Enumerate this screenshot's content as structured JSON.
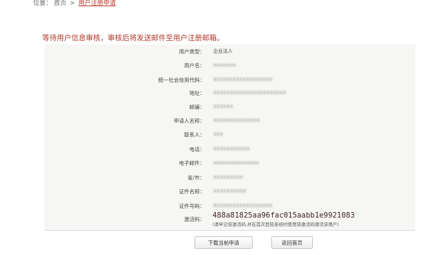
{
  "breadcrumb": {
    "prefix": "位置：",
    "home": "首页",
    "separator": ">",
    "current": "用户注册申请"
  },
  "notice": "等待用户信息审核，审核后将发送邮件至用户注册邮箱。",
  "form": {
    "rows": [
      {
        "label": "用户类型：",
        "value": "企业法人"
      },
      {
        "label": "用户名：",
        "value": "xxxxxxxx"
      },
      {
        "label": "统一社会信用代码：",
        "value": "91XXXXXXXXXXXXXXXX"
      },
      {
        "label": "地址：",
        "value": "XXXXXXXXXXXXXXXXXXXXXX"
      },
      {
        "label": "邮编：",
        "value": "XXXXXX"
      },
      {
        "label": "申请人名称：",
        "value": "XXXXXXXXXXXXXX"
      },
      {
        "label": "联系人：",
        "value": "XXX"
      },
      {
        "label": "电话：",
        "value": "XXXXXXXXXXX"
      },
      {
        "label": "电子邮件：",
        "value": "xxxxxxxxxxxxxxxx"
      },
      {
        "label": "省/市：",
        "value": "XXXXXXXXX"
      },
      {
        "label": "证件名称：",
        "value": "XXXXXXXXXX"
      },
      {
        "label": "证件号码：",
        "value": "91XXXXXXXXXXXXXXXX"
      }
    ],
    "activation": {
      "label": "激活码：",
      "code": "488a81825aa96fac015aabb1e9921083",
      "note": "(请牢记该激活码,并在首次登陆系统时使用该激活码激活该用户)"
    }
  },
  "buttons": {
    "download": "下载当前申请",
    "home": "返回首页"
  }
}
